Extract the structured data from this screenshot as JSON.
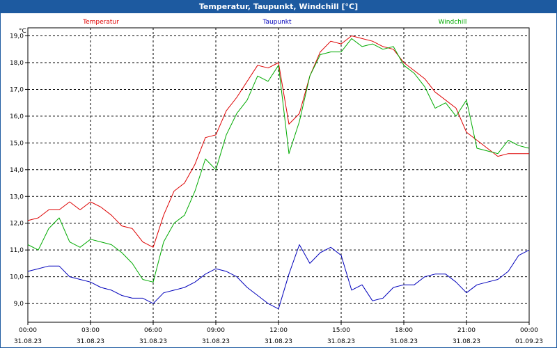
{
  "window": {
    "title": "Temperatur, Taupunkt, Windchill [°C]"
  },
  "chart_data": {
    "type": "line",
    "title": "Temperatur, Taupunkt, Windchill [°C]",
    "ylabel": "°C",
    "ylim": [
      8.3,
      19.3
    ],
    "y_ticks": [
      9.0,
      10.0,
      11.0,
      12.0,
      13.0,
      14.0,
      15.0,
      16.0,
      17.0,
      18.0,
      19.0
    ],
    "y_tick_labels": [
      "9,0",
      "10,0",
      "11,0",
      "12,0",
      "13,0",
      "14,0",
      "15,0",
      "16,0",
      "17,0",
      "18,0",
      "19,0"
    ],
    "xlim": [
      0,
      24
    ],
    "x_ticks": [
      {
        "hour": 0,
        "time": "00:00",
        "date": "31.08.23"
      },
      {
        "hour": 3,
        "time": "03:00",
        "date": "31.08.23"
      },
      {
        "hour": 6,
        "time": "06:00",
        "date": "31.08.23"
      },
      {
        "hour": 9,
        "time": "09:00",
        "date": "31.08.23"
      },
      {
        "hour": 12,
        "time": "12:00",
        "date": "31.08.23"
      },
      {
        "hour": 15,
        "time": "15:00",
        "date": "31.08.23"
      },
      {
        "hour": 18,
        "time": "18:00",
        "date": "31.08.23"
      },
      {
        "hour": 21,
        "time": "21:00",
        "date": "31.08.23"
      },
      {
        "hour": 24,
        "time": "00:00",
        "date": "01.09.23"
      }
    ],
    "grid": true,
    "legend_position": "top",
    "series": [
      {
        "name": "Temperatur",
        "color": "#dd0000",
        "x": [
          0,
          0.5,
          1,
          1.5,
          2,
          2.5,
          3,
          3.5,
          4,
          4.5,
          5,
          5.5,
          6,
          6.5,
          7,
          7.5,
          8,
          8.5,
          9,
          9.5,
          10,
          10.5,
          11,
          11.5,
          12,
          12.5,
          13,
          13.5,
          14,
          14.5,
          15,
          15.5,
          16,
          16.5,
          17,
          17.5,
          18,
          18.5,
          19,
          19.5,
          20,
          20.5,
          21,
          21.5,
          22,
          22.5,
          23,
          23.5,
          24
        ],
        "y": [
          12.1,
          12.2,
          12.5,
          12.5,
          12.8,
          12.5,
          12.8,
          12.6,
          12.3,
          11.9,
          11.8,
          11.3,
          11.1,
          12.3,
          13.2,
          13.5,
          14.2,
          15.2,
          15.3,
          16.2,
          16.7,
          17.3,
          17.9,
          17.8,
          18.0,
          15.7,
          16.1,
          17.5,
          18.4,
          18.8,
          18.7,
          19.0,
          18.9,
          18.8,
          18.6,
          18.5,
          18.0,
          17.7,
          17.4,
          16.9,
          16.6,
          16.3,
          15.4,
          15.1,
          14.8,
          14.5,
          14.6,
          14.6,
          14.6
        ]
      },
      {
        "name": "Taupunkt",
        "color": "#0000bb",
        "x": [
          0,
          0.5,
          1,
          1.5,
          2,
          2.5,
          3,
          3.5,
          4,
          4.5,
          5,
          5.5,
          6,
          6.5,
          7,
          7.5,
          8,
          8.5,
          9,
          9.5,
          10,
          10.5,
          11,
          11.5,
          12,
          12.5,
          13,
          13.5,
          14,
          14.5,
          15,
          15.5,
          16,
          16.5,
          17,
          17.5,
          18,
          18.5,
          19,
          19.5,
          20,
          20.5,
          21,
          21.5,
          22,
          22.5,
          23,
          23.5,
          24
        ],
        "y": [
          10.2,
          10.3,
          10.4,
          10.4,
          10.0,
          9.9,
          9.8,
          9.6,
          9.5,
          9.3,
          9.2,
          9.2,
          9.0,
          9.4,
          9.5,
          9.6,
          9.8,
          10.1,
          10.3,
          10.2,
          10.0,
          9.6,
          9.3,
          9.0,
          8.8,
          10.1,
          11.2,
          10.5,
          10.9,
          11.1,
          10.8,
          9.5,
          9.7,
          9.1,
          9.2,
          9.6,
          9.7,
          9.7,
          10.0,
          10.1,
          10.1,
          9.8,
          9.4,
          9.7,
          9.8,
          9.9,
          10.2,
          10.8,
          11.0
        ]
      },
      {
        "name": "Windchill",
        "color": "#00aa00",
        "x": [
          0,
          0.5,
          1,
          1.5,
          2,
          2.5,
          3,
          3.5,
          4,
          4.5,
          5,
          5.5,
          6,
          6.5,
          7,
          7.5,
          8,
          8.5,
          9,
          9.5,
          10,
          10.5,
          11,
          11.5,
          12,
          12.5,
          13,
          13.5,
          14,
          14.5,
          15,
          15.5,
          16,
          16.5,
          17,
          17.5,
          18,
          18.5,
          19,
          19.5,
          20,
          20.5,
          21,
          21.5,
          22,
          22.5,
          23,
          23.5,
          24
        ],
        "y": [
          11.2,
          11.0,
          11.8,
          12.2,
          11.3,
          11.1,
          11.4,
          11.3,
          11.2,
          10.9,
          10.5,
          9.9,
          9.8,
          11.3,
          12.0,
          12.3,
          13.2,
          14.4,
          14.0,
          15.3,
          16.1,
          16.6,
          17.5,
          17.3,
          17.9,
          14.6,
          15.8,
          17.5,
          18.3,
          18.4,
          18.4,
          18.9,
          18.6,
          18.7,
          18.5,
          18.6,
          17.9,
          17.6,
          17.1,
          16.3,
          16.5,
          16.0,
          16.6,
          14.8,
          14.7,
          14.6,
          15.1,
          14.9,
          14.8
        ]
      }
    ]
  }
}
